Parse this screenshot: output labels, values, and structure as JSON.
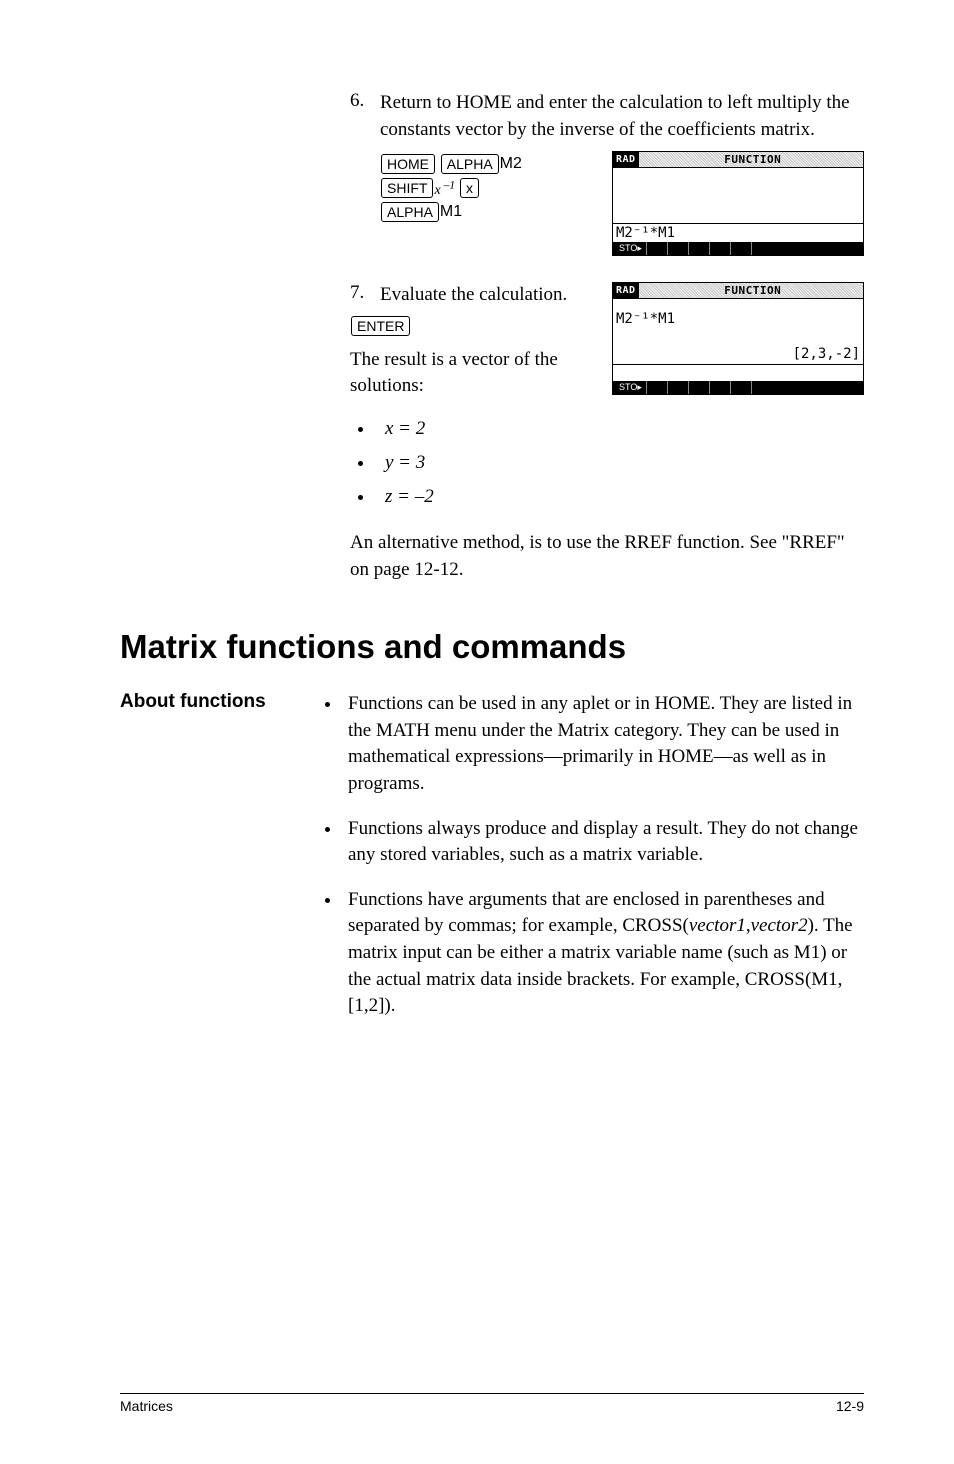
{
  "step6": {
    "num": "6.",
    "text": "Return to HOME and enter the calculation to left multiply the constants vector by the inverse of the coefficients matrix.",
    "keys": {
      "line1_home": "HOME",
      "line1_alpha": "ALPHA",
      "line1_m2": "M2",
      "line2_shift": "SHIFT",
      "line2_xinv": "x",
      "line2_sup": " –1",
      "line2_xkey": "x",
      "line3_alpha": "ALPHA",
      "line3_m1": "M1"
    },
    "screen": {
      "rad": "RAD",
      "title": "FUNCTION",
      "input": "M2⁻¹*M1",
      "menu": "STO▸"
    }
  },
  "step7": {
    "num": "7.",
    "text": "Evaluate the calculation.",
    "key_enter": "ENTER",
    "result_intro": "The result is a vector of the solutions:",
    "screen": {
      "rad": "RAD",
      "title": "FUNCTION",
      "hist_left": "M2⁻¹*M1",
      "hist_right": "[2,3,-2]",
      "menu": "STO▸"
    }
  },
  "solutions": {
    "x": "x  =  2",
    "y": "y  =  3",
    "z": "z  =  –2"
  },
  "alt_note": "An alternative method, is to use the RREF function. See \"RREF\" on page 12-12.",
  "section_title": "Matrix functions and commands",
  "about_label": "About functions",
  "about_items": [
    "Functions can be used in any aplet or in HOME. They are listed in the MATH menu under the Matrix category. They can be used in mathematical expressions—primarily in HOME—as well as in programs.",
    "Functions always produce and display a result. They do not change any stored variables, such as a matrix variable.",
    "Functions have arguments that are enclosed in parentheses and separated by commas; for example, CROSS(vector1,vector2). The matrix input can be either a matrix variable name (such as M1) or the actual matrix data inside brackets. For example, CROSS(M1,[1,2])."
  ],
  "footer_left": "Matrices",
  "footer_right": "12-9",
  "chart_data": {
    "type": "document-page",
    "section": "Matrices",
    "page": "12-9",
    "steps": [
      {
        "n": 6,
        "action": "enter M2^-1*M1 in HOME"
      },
      {
        "n": 7,
        "action": "press ENTER",
        "result": "[2,3,-2]"
      }
    ],
    "solutions": {
      "x": 2,
      "y": 3,
      "z": -2
    },
    "cross_reference": {
      "function": "RREF",
      "page": "12-12"
    }
  }
}
